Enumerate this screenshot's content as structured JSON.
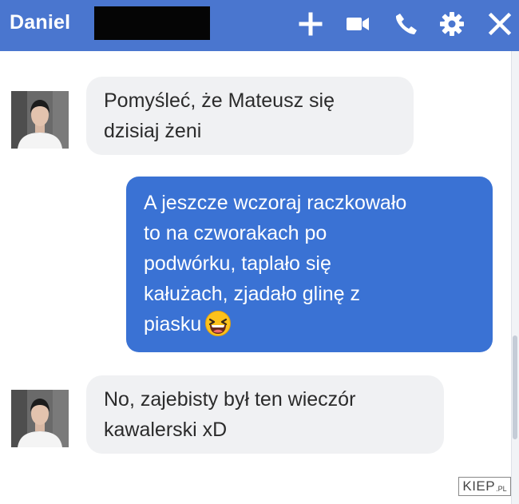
{
  "header": {
    "contact_name": "Daniel",
    "icons": [
      "plus-icon",
      "video-camera-icon",
      "phone-icon",
      "gear-icon",
      "close-icon"
    ],
    "color": "#4a76cf"
  },
  "messages": [
    {
      "direction": "incoming",
      "text_lines": [
        "Pomyśleć, że Mateusz się",
        "dzisiaj żeni"
      ]
    },
    {
      "direction": "outgoing",
      "text_lines": [
        "A jeszcze wczoraj raczkowało",
        "to na czworakach po",
        "podwórku, taplało się",
        "kałużach, zjadało glinę z",
        "piasku"
      ],
      "emoji": "laughing-emoji"
    },
    {
      "direction": "incoming",
      "text_lines": [
        "No, zajebisty był ten wieczór",
        "kawalerski xD"
      ]
    }
  ],
  "watermark": {
    "main": "KIEP",
    "sub": ".PL"
  },
  "colors": {
    "outgoing_bubble": "#3a72d4",
    "incoming_bubble": "#f0f1f3"
  }
}
